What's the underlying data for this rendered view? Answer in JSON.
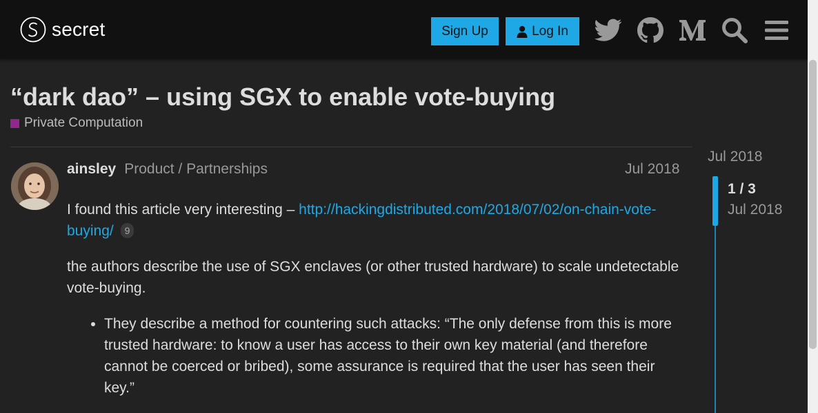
{
  "header": {
    "brand": "secret",
    "signup_label": "Sign Up",
    "login_label": "Log In",
    "icons": [
      "twitter-icon",
      "github-icon",
      "medium-icon",
      "search-icon",
      "hamburger-menu-icon"
    ]
  },
  "topic": {
    "title": "“dark dao” – using SGX to enable vote-buying",
    "category": "Private Computation",
    "category_color": "#92278f"
  },
  "post": {
    "username": "ainsley",
    "user_title": "Product / Partnerships",
    "date": "Jul 2018",
    "p1_text": "I found this article very interesting – ",
    "p1_link": "http://hackingdistributed.com/2018/07/02/on-chain-vote-buying/",
    "p1_link_clicks": "9",
    "p2": "the authors describe the use of SGX enclaves (or other trusted hardware) to scale undetectable vote-buying.",
    "bullet1": "They describe a method for countering such attacks: “The only defense from this is more trusted hardware: to know a user has access to their own key material (and therefore cannot be coerced or bribed), some assurance is required that the user has seen their key.”"
  },
  "timeline": {
    "start_date": "Jul 2018",
    "position": "1 / 3",
    "current_date": "Jul 2018"
  },
  "colors": {
    "accent": "#1fa8e6",
    "header_bg": "#111111",
    "page_bg": "#222222"
  }
}
